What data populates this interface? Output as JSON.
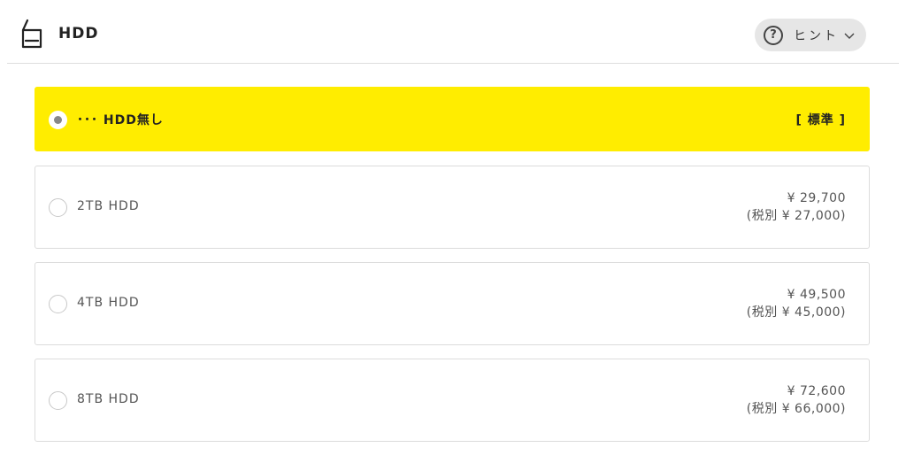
{
  "header": {
    "title": "HDD",
    "icon": "hdd-icon",
    "hint_label": "ヒント"
  },
  "options": [
    {
      "label": "･･･ HDD無し",
      "standard": "[ 標準 ]",
      "selected": true
    },
    {
      "label": "2TB HDD",
      "price": "¥ 29,700",
      "price_ex_tax": "(税別 ¥ 27,000)",
      "selected": false
    },
    {
      "label": "4TB HDD",
      "price": "¥ 49,500",
      "price_ex_tax": "(税別 ¥ 45,000)",
      "selected": false
    },
    {
      "label": "8TB HDD",
      "price": "¥ 72,600",
      "price_ex_tax": "(税別 ¥ 66,000)",
      "selected": false
    }
  ],
  "colors": {
    "selected_bg": "#ffed00",
    "border": "#dcdcdc",
    "hint_bg": "#e6e6e6"
  }
}
